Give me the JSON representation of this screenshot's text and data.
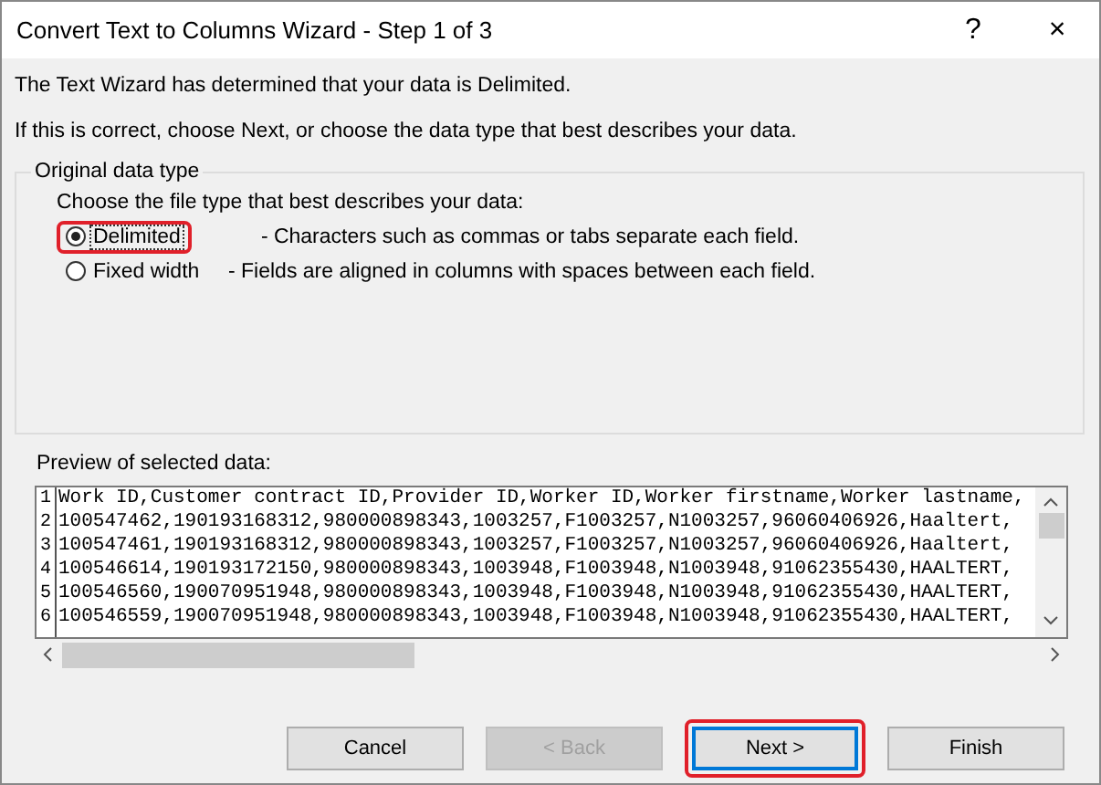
{
  "window": {
    "title": "Convert Text to Columns Wizard - Step 1 of 3",
    "help": "?",
    "close": "×"
  },
  "intro": [
    "The Text Wizard has determined that your data is Delimited.",
    "If this is correct, choose Next, or choose the data type that best describes your data."
  ],
  "group": {
    "title": "Original data type",
    "prompt": "Choose the file type that best describes your data:",
    "options": [
      {
        "label": "Delimited",
        "description": "- Characters such as commas or tabs separate each field.",
        "selected": true,
        "highlighted": true
      },
      {
        "label": "Fixed width",
        "description": "- Fields are aligned in columns with spaces between each field.",
        "selected": false,
        "highlighted": false
      }
    ]
  },
  "preview": {
    "label": "Preview of selected data:",
    "rows": [
      {
        "number": "1",
        "text": "Work ID,Customer contract ID,Provider ID,Worker ID,Worker firstname,Worker lastname,"
      },
      {
        "number": "2",
        "text": "100547462,190193168312,980000898343,1003257,F1003257,N1003257,96060406926,Haaltert,"
      },
      {
        "number": "3",
        "text": "100547461,190193168312,980000898343,1003257,F1003257,N1003257,96060406926,Haaltert,"
      },
      {
        "number": "4",
        "text": "100546614,190193172150,980000898343,1003948,F1003948,N1003948,91062355430,HAALTERT,"
      },
      {
        "number": "5",
        "text": "100546560,190070951948,980000898343,1003948,F1003948,N1003948,91062355430,HAALTERT,"
      },
      {
        "number": "6",
        "text": "100546559,190070951948,980000898343,1003948,F1003948,N1003948,91062355430,HAALTERT,"
      }
    ]
  },
  "buttons": [
    {
      "label": "Cancel",
      "disabled": false,
      "highlighted": false
    },
    {
      "label": "< Back",
      "disabled": true,
      "highlighted": false
    },
    {
      "label": "Next >",
      "disabled": false,
      "highlighted": true
    },
    {
      "label": "Finish",
      "disabled": false,
      "highlighted": false
    }
  ]
}
